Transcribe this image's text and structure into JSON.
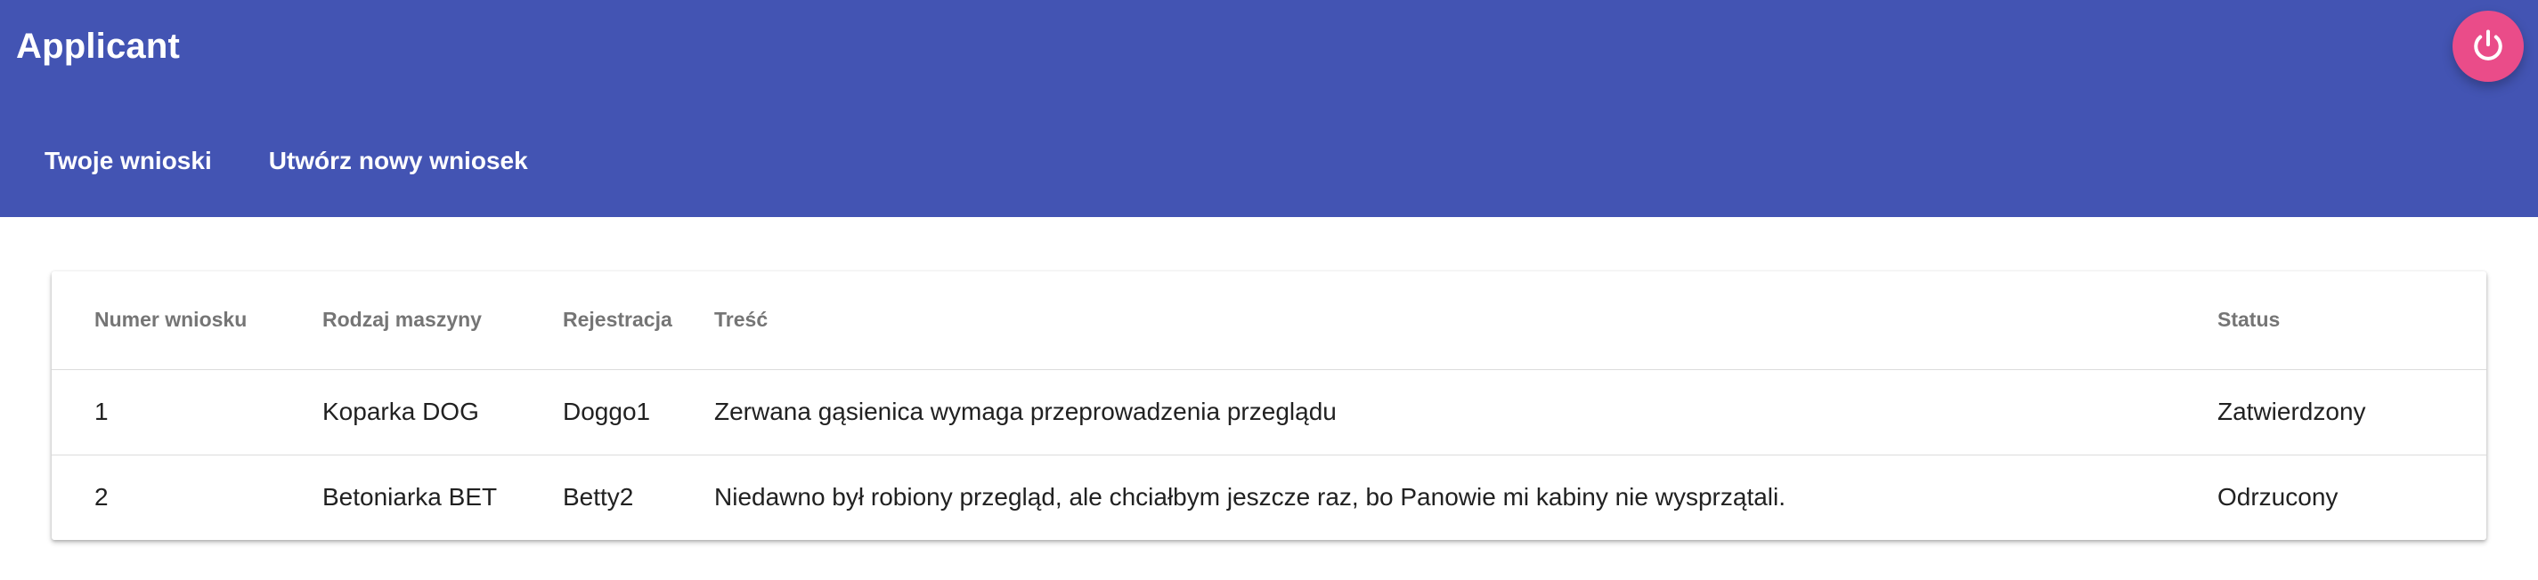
{
  "app": {
    "title": "Applicant"
  },
  "nav": {
    "tabs": [
      {
        "label": "Twoje wnioski"
      },
      {
        "label": "Utwórz nowy wniosek"
      }
    ]
  },
  "colors": {
    "header_bg": "#4354b3",
    "power_button_bg": "#ea4c89"
  },
  "icons": {
    "power": "power-icon"
  },
  "table": {
    "columns": [
      "Numer wniosku",
      "Rodzaj maszyny",
      "Rejestracja",
      "Treść",
      "Status"
    ],
    "rows": [
      [
        "1",
        "Koparka DOG",
        "Doggo1",
        "Zerwana gąsienica wymaga przeprowadzenia przeglądu",
        "Zatwierdzony"
      ],
      [
        "2",
        "Betoniarka BET",
        "Betty2",
        "Niedawno był robiony przegląd, ale chciałbym jeszcze raz, bo Panowie mi kabiny nie wysprzątali.",
        "Odrzucony"
      ]
    ]
  }
}
